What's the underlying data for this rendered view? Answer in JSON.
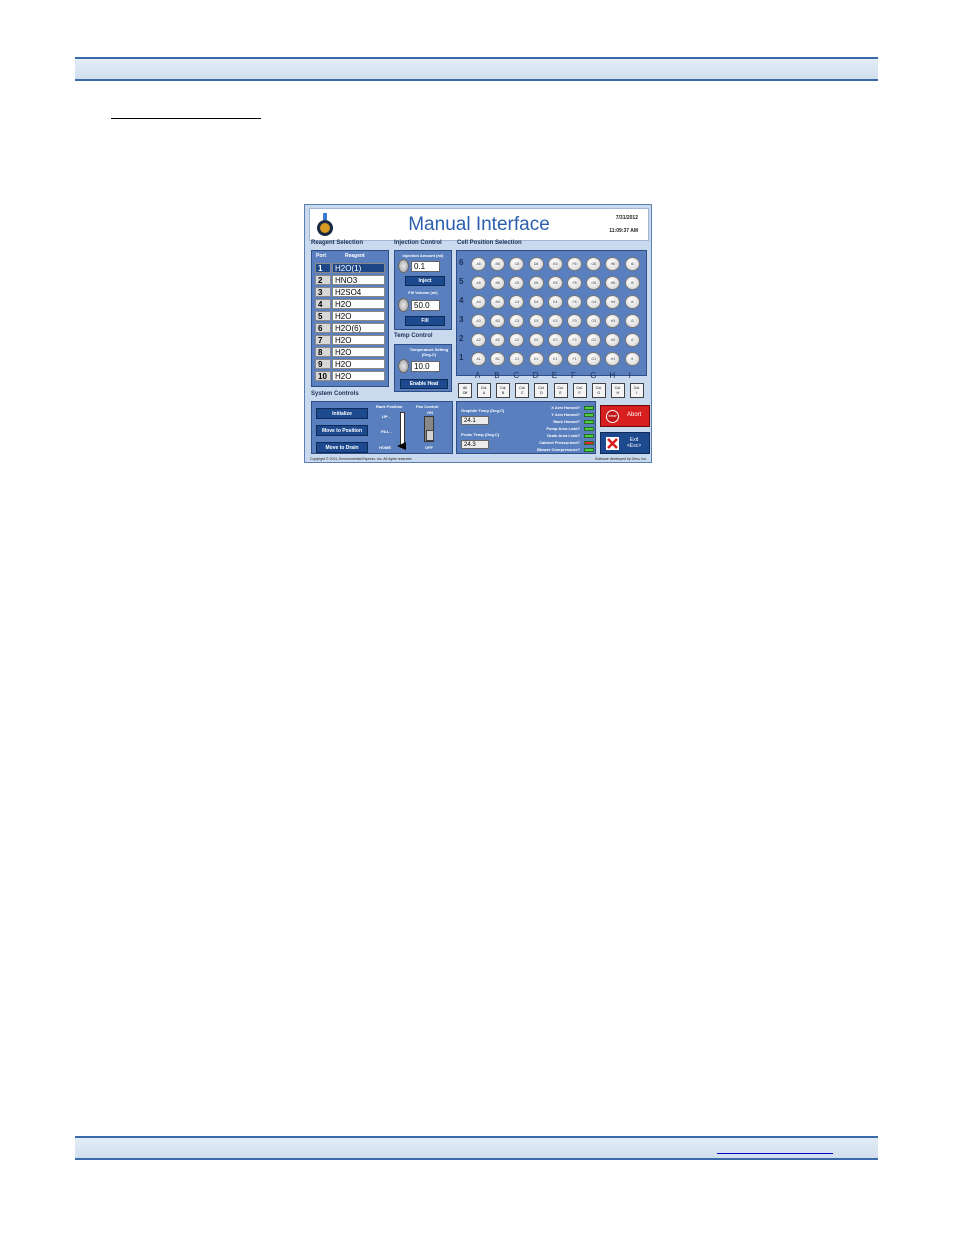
{
  "app": {
    "title": "Manual Interface",
    "date": "7/31/2012",
    "time": "11:09:37 AM",
    "copyright": "Copyright © 2011, Environmental Express, Inc.   All rights reserved.",
    "developer": "Software developed by Orbo, Inc."
  },
  "sections": {
    "reagent": "Reagent Selection",
    "injection": "Injection Control",
    "cell": "Cell Position Selection",
    "temp": "Temp Control",
    "system": "System Controls"
  },
  "reagent_table": {
    "headers": [
      "Port",
      "Reagent"
    ],
    "selected_index": 0,
    "rows": [
      {
        "port": "1",
        "reagent": "H2O(1)"
      },
      {
        "port": "2",
        "reagent": "HNO3"
      },
      {
        "port": "3",
        "reagent": "H2SO4"
      },
      {
        "port": "4",
        "reagent": "H2O"
      },
      {
        "port": "5",
        "reagent": "H2O"
      },
      {
        "port": "6",
        "reagent": "H2O(6)"
      },
      {
        "port": "7",
        "reagent": "H2O"
      },
      {
        "port": "8",
        "reagent": "H2O"
      },
      {
        "port": "9",
        "reagent": "H2O"
      },
      {
        "port": "10",
        "reagent": "H2O"
      }
    ]
  },
  "injection": {
    "amount_label": "Injection Amount (ml)",
    "amount_value": "0.1",
    "inject_button": "Inject",
    "fill_label": "Fill Volume (ml)",
    "fill_value": "50.0",
    "fill_button": "Fill"
  },
  "temp": {
    "setting_label": "Temperature Setting (Deg.C)",
    "setting_value": "10.0",
    "enable_button": "Enable Heat"
  },
  "grid": {
    "rows": [
      "6",
      "5",
      "4",
      "3",
      "2",
      "1"
    ],
    "cols": [
      "A",
      "B",
      "C",
      "D",
      "E",
      "F",
      "G",
      "H",
      "I"
    ],
    "col_buttons": [
      [
        "All",
        "Off"
      ],
      [
        "Col.",
        "A"
      ],
      [
        "Col.",
        "B"
      ],
      [
        "Col.",
        "C"
      ],
      [
        "Col.",
        "D"
      ],
      [
        "Col.",
        "E"
      ],
      [
        "Col.",
        "F"
      ],
      [
        "Col.",
        "G"
      ],
      [
        "Col.",
        "H"
      ],
      [
        "Col.",
        "I"
      ]
    ]
  },
  "system": {
    "initialize": "Initialize",
    "move_position": "Move to Position",
    "move_drain": "Move to Drain",
    "rack_label": "Rack Position",
    "rack_up": "UP -",
    "rack_fill": "FILL -",
    "rack_home": "HOME",
    "fan_label": "Fan Control",
    "fan_on": "ON",
    "fan_off": "OFF"
  },
  "sensors": {
    "graphite_label": "Graphite Temp (Deg.C)",
    "graphite_value": "24.1",
    "probe_label": "Probe Temp (Deg.C)",
    "probe_value": "24.3"
  },
  "status": [
    {
      "label": "X Arm Homed?",
      "color": "#4ccf43"
    },
    {
      "label": "Y Arm Homed?",
      "color": "#4ccf43"
    },
    {
      "label": "Rack Homed?",
      "color": "#4ccf43"
    },
    {
      "label": "Pump Area Leak?",
      "color": "#4ccf43"
    },
    {
      "label": "Drain Area Leak?",
      "color": "#4ccf43"
    },
    {
      "label": "Cabinet Pressurized?",
      "color": "#e02a2a"
    },
    {
      "label": "Blower Overpressure?",
      "color": "#4ccf43"
    }
  ],
  "buttons": {
    "abort": "Abort",
    "abort_icon": "STOP",
    "exit": "Exit",
    "exit_key": "<Esc>"
  }
}
